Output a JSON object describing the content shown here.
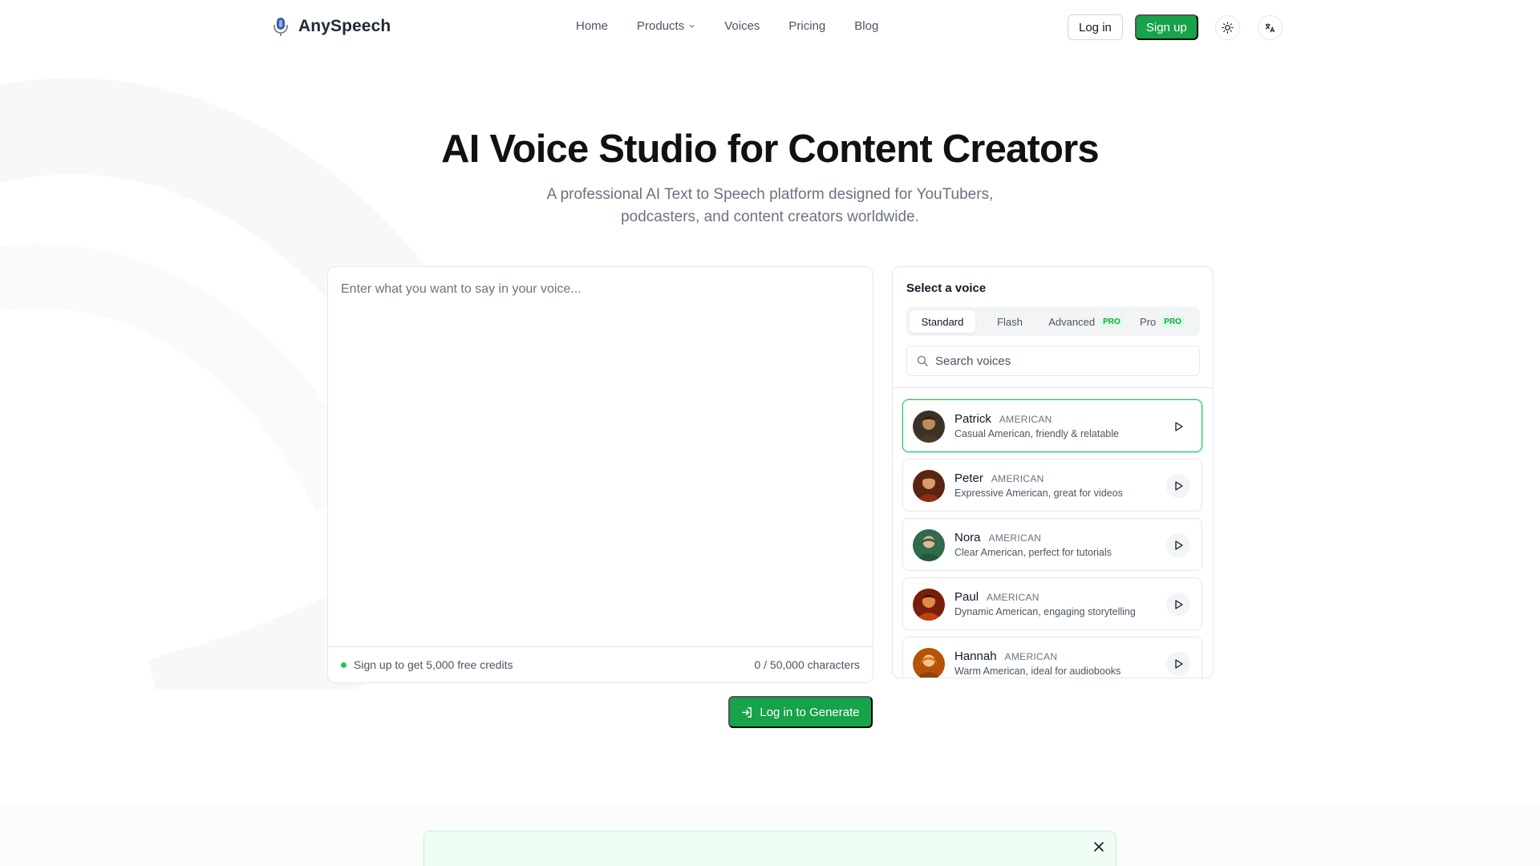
{
  "brand": {
    "name": "AnySpeech"
  },
  "nav": {
    "links": [
      "Home",
      "Products",
      "Voices",
      "Pricing",
      "Blog"
    ],
    "login": "Log in",
    "signup": "Sign up"
  },
  "hero": {
    "title": "AI Voice Studio for Content Creators",
    "subtitle": "A professional AI Text to Speech platform designed for YouTubers, podcasters, and content creators worldwide."
  },
  "editor": {
    "placeholder": "Enter what you want to say in your voice...",
    "credits_note": "Sign up to get 5,000 free credits",
    "char_count": "0 / 50,000 characters"
  },
  "generate_button": "Log in to Generate",
  "voice_panel": {
    "title": "Select a voice",
    "tabs": [
      {
        "label": "Standard",
        "badge": ""
      },
      {
        "label": "Flash",
        "badge": ""
      },
      {
        "label": "Advanced",
        "badge": "PRO"
      },
      {
        "label": "Pro",
        "badge": "PRO"
      }
    ],
    "active_tab": "Standard",
    "search_placeholder": "Search voices",
    "voices": [
      {
        "name": "Patrick",
        "accent": "AMERICAN",
        "description": "Casual American, friendly & relatable",
        "selected": true
      },
      {
        "name": "Peter",
        "accent": "AMERICAN",
        "description": "Expressive American, great for videos",
        "selected": false
      },
      {
        "name": "Nora",
        "accent": "AMERICAN",
        "description": "Clear American, perfect for tutorials",
        "selected": false
      },
      {
        "name": "Paul",
        "accent": "AMERICAN",
        "description": "Dynamic American, engaging storytelling",
        "selected": false
      },
      {
        "name": "Hannah",
        "accent": "AMERICAN",
        "description": "Warm American, ideal for audiobooks",
        "selected": false
      }
    ]
  },
  "colors": {
    "accent": "#16a34a",
    "selected_border": "#22c55e"
  },
  "icons": [
    "microphone-logo-icon",
    "chevron-down-icon",
    "sun-icon",
    "translate-icon",
    "search-icon",
    "play-icon",
    "login-icon",
    "close-icon"
  ]
}
